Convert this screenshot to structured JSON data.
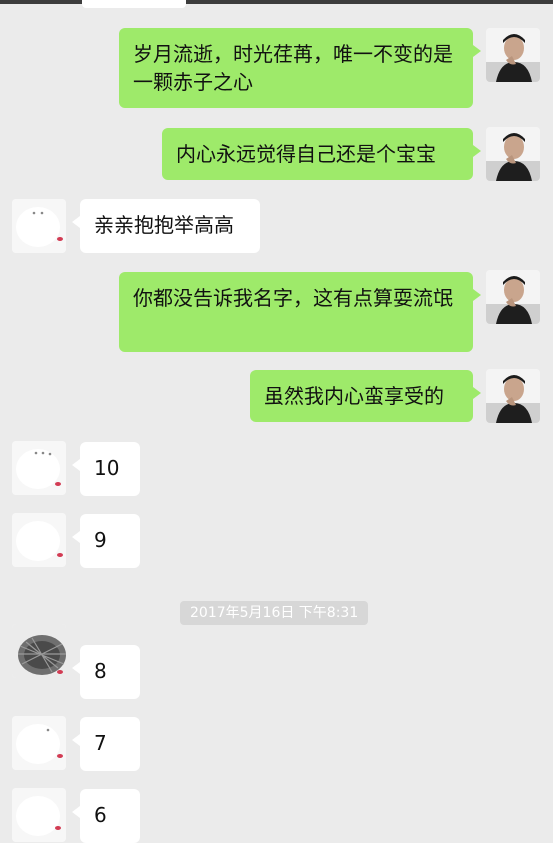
{
  "messages": [
    {
      "id": "m1",
      "side": "me",
      "text": "岁月流逝，时光荏苒，唯一不变的是一颗赤子之心"
    },
    {
      "id": "m2",
      "side": "me",
      "text": "内心永远觉得自己还是个宝宝"
    },
    {
      "id": "m3",
      "side": "other",
      "text": "亲亲抱抱举高高"
    },
    {
      "id": "m4",
      "side": "me",
      "text": "你都没告诉我名字，这有点算耍流氓"
    },
    {
      "id": "m5",
      "side": "me",
      "text": "虽然我内心蛮享受的"
    },
    {
      "id": "m6",
      "side": "other",
      "text": "10"
    },
    {
      "id": "m7",
      "side": "other",
      "text": "9"
    },
    {
      "id": "m8",
      "side": "other",
      "text": "8"
    },
    {
      "id": "m9",
      "side": "other",
      "text": "7"
    },
    {
      "id": "m10",
      "side": "other",
      "text": "6"
    }
  ],
  "timestamp": "2017年5月16日 下午8:31",
  "colors": {
    "background": "#ebebeb",
    "sent_bubble": "#9eea6a",
    "received_bubble": "#ffffff",
    "timestamp_pill": "#d7d7d7"
  }
}
